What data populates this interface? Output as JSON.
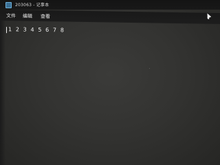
{
  "window": {
    "title": "203063 - 记事本",
    "icon": "notepad-icon"
  },
  "menu": {
    "items": [
      {
        "label": "文件"
      },
      {
        "label": "编辑"
      },
      {
        "label": "查看"
      }
    ]
  },
  "editor": {
    "content": "1 2 3 4 5 6 7 8"
  },
  "pointer": {
    "icon": "mouse-pointer-icon"
  },
  "colors": {
    "titlebar": "#141414",
    "menubar": "#1b1b1b",
    "editor_background": "#353533",
    "text": "#f0f0f0"
  }
}
